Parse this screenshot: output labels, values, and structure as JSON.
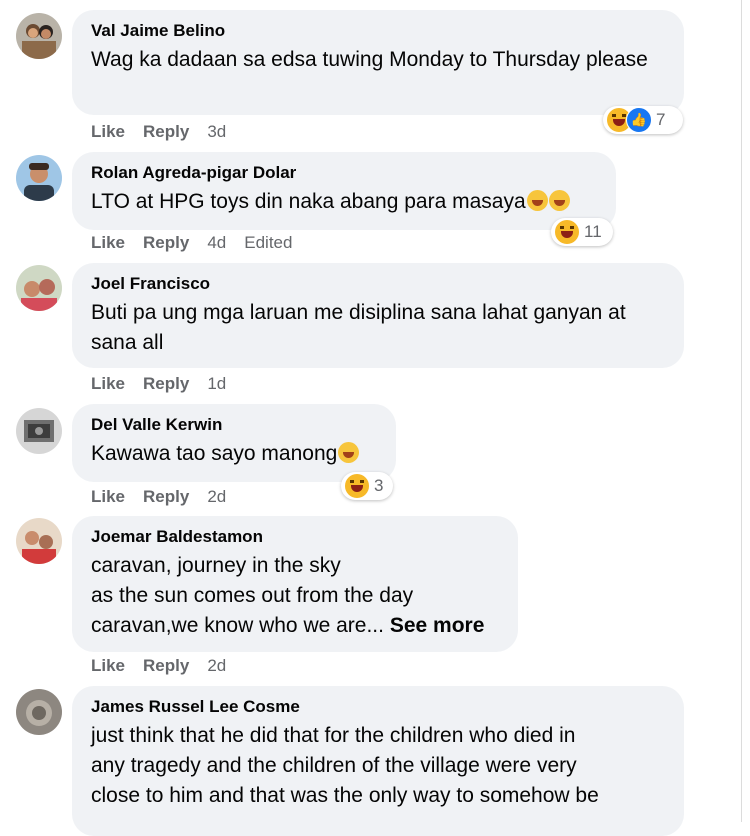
{
  "actions": {
    "like": "Like",
    "reply": "Reply"
  },
  "comments": [
    {
      "author": "Val Jaime Belino",
      "text": "Wag ka dadaan sa edsa tuwing Monday to Thursday please",
      "time": "3d",
      "reaction_count": "7",
      "reactions": [
        "haha",
        "like"
      ]
    },
    {
      "author": "Rolan Agreda-pigar Dolar",
      "text": "LTO at HPG toys din naka abang para masaya",
      "time": "4d",
      "edited": "Edited",
      "reaction_count": "11",
      "reactions": [
        "haha"
      ]
    },
    {
      "author": "Joel Francisco",
      "text": "Buti pa ung mga laruan me disiplina sana lahat ganyan at sana all",
      "time": "1d"
    },
    {
      "author": "Del Valle Kerwin",
      "text": "Kawawa tao sayo manong",
      "time": "2d",
      "reaction_count": "3",
      "reactions": [
        "haha"
      ]
    },
    {
      "author": "Joemar Baldestamon",
      "text_lines": [
        "caravan, journey in the sky",
        "as the sun comes out from the day",
        "caravan,we know who we are..."
      ],
      "see_more": "See more",
      "time": "2d"
    },
    {
      "author": "James Russel Lee Cosme",
      "text_lines": [
        "just think that he did that for the children who died in",
        "any tragedy and the children of the village were very",
        "close to him and that was the only way to somehow be"
      ]
    }
  ]
}
